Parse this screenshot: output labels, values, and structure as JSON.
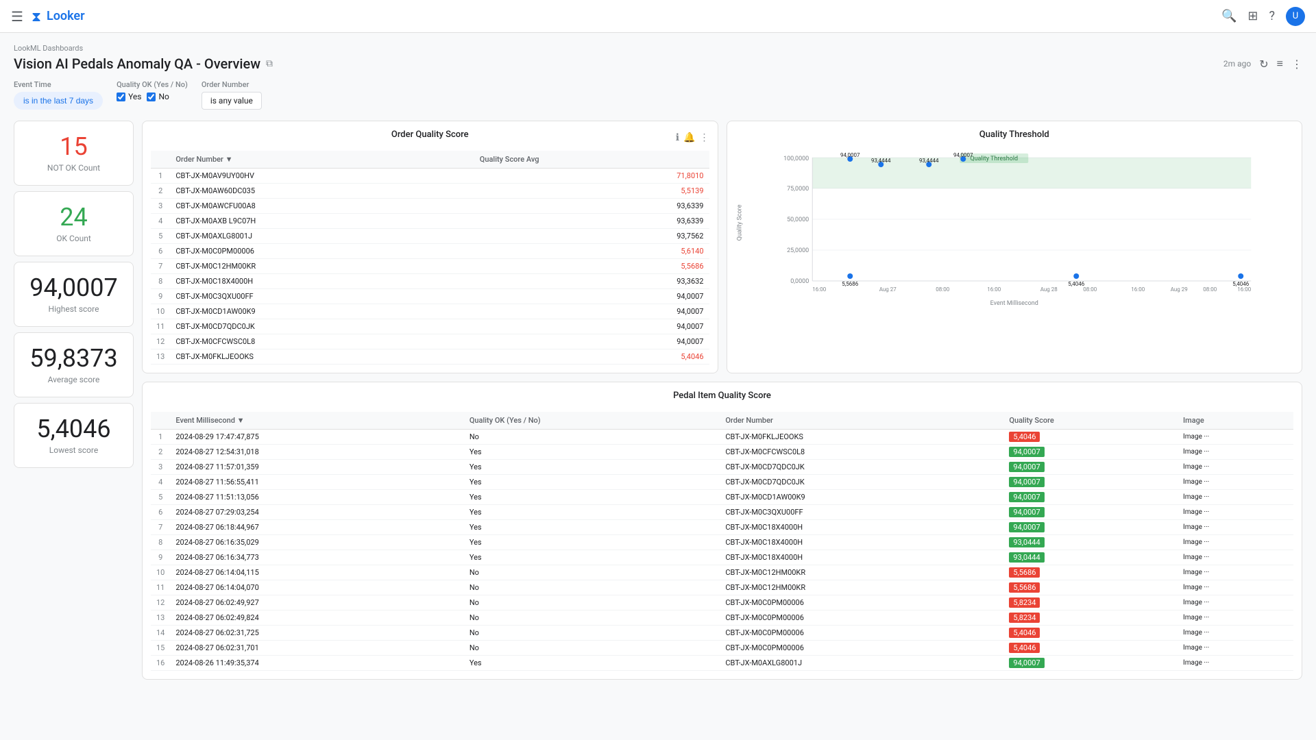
{
  "nav": {
    "logo": "Looker",
    "icons": [
      "☰",
      "⊞",
      "?",
      "👤"
    ]
  },
  "header": {
    "breadcrumb": "LookML Dashboards",
    "title": "Vision AI Pedals Anomaly QA - Overview",
    "last_updated": "2m ago"
  },
  "filters": {
    "event_time_label": "Event Time",
    "event_time_value": "is in the last 7 days",
    "quality_ok_label": "Quality OK (Yes / No)",
    "quality_ok_yes": "Yes",
    "quality_ok_no": "No",
    "order_number_label": "Order Number",
    "order_number_value": "is any value"
  },
  "kpis": {
    "not_ok_value": "15",
    "not_ok_label": "NOT OK Count",
    "ok_value": "24",
    "ok_label": "OK Count",
    "highest_value": "94,0007",
    "highest_label": "Highest score",
    "average_value": "59,8373",
    "average_label": "Average score",
    "lowest_value": "5,4046",
    "lowest_label": "Lowest score"
  },
  "order_quality_score": {
    "title": "Order Quality Score",
    "columns": [
      "",
      "Order Number",
      "Quality Score Avg"
    ],
    "rows": [
      {
        "num": 1,
        "order": "CBT-JX-M0AV9UY00HV",
        "score": "71,8010",
        "red": true
      },
      {
        "num": 2,
        "order": "CBT-JX-M0AW60DC035",
        "score": "5,5139",
        "red": true
      },
      {
        "num": 3,
        "order": "CBT-JX-M0AWCFU00A8",
        "score": "93,6339",
        "red": false
      },
      {
        "num": 4,
        "order": "CBT-JX-M0AXB L9C07H",
        "score": "93,6339",
        "red": false
      },
      {
        "num": 5,
        "order": "CBT-JX-M0AXLG8001J",
        "score": "93,7562",
        "red": false
      },
      {
        "num": 6,
        "order": "CBT-JX-M0C0PM00006",
        "score": "5,6140",
        "red": true
      },
      {
        "num": 7,
        "order": "CBT-JX-M0C12HM00KR",
        "score": "5,5686",
        "red": true
      },
      {
        "num": 8,
        "order": "CBT-JX-M0C18X4000H",
        "score": "93,3632",
        "red": false
      },
      {
        "num": 9,
        "order": "CBT-JX-M0C3QXU00FF",
        "score": "94,0007",
        "red": false
      },
      {
        "num": 10,
        "order": "CBT-JX-M0CD1AW00K9",
        "score": "94,0007",
        "red": false
      },
      {
        "num": 11,
        "order": "CBT-JX-M0CD7QDC0JK",
        "score": "94,0007",
        "red": false
      },
      {
        "num": 12,
        "order": "CBT-JX-M0CFCWSC0L8",
        "score": "94,0007",
        "red": false
      },
      {
        "num": 13,
        "order": "CBT-JX-M0FKLJEOOKS",
        "score": "5,4046",
        "red": true
      }
    ]
  },
  "quality_threshold": {
    "title": "Quality Threshold",
    "legend": "Quality Threshold",
    "y_axis_label": "Quality Score",
    "x_axis_label": "Event Millisecond",
    "y_ticks": [
      "100,0000",
      "75,0000",
      "50,0000",
      "25,0000",
      "0,0000"
    ],
    "x_ticks": [
      "16:00",
      "Aug 27",
      "08:00",
      "16:00",
      "Aug 28",
      "08:00",
      "16:00",
      "Aug 29",
      "08:00",
      "16:00"
    ],
    "points": [
      {
        "x": 70,
        "y": 15,
        "label": "94,0007",
        "color": "#1a73e8"
      },
      {
        "x": 100,
        "y": 12,
        "label": "93,4444",
        "color": "#1a73e8"
      },
      {
        "x": 160,
        "y": 12,
        "label": "93,4444",
        "color": "#1a73e8"
      },
      {
        "x": 210,
        "y": 12,
        "label": "94,0007",
        "color": "#1a73e8"
      },
      {
        "x": 330,
        "y": 82,
        "label": "5,5686",
        "color": "#1a73e8"
      },
      {
        "x": 440,
        "y": 82,
        "label": "5,4046",
        "color": "#1a73e8"
      },
      {
        "x": 800,
        "y": 82,
        "label": "5,4046",
        "color": "#1a73e8"
      }
    ]
  },
  "pedal_item_quality_score": {
    "title": "Pedal Item Quality Score",
    "columns": [
      "",
      "Event Millisecond",
      "Quality OK (Yes / No)",
      "Order Number",
      "Quality Score",
      "Image"
    ],
    "rows": [
      {
        "num": 1,
        "time": "2024-08-29 17:47:47,875",
        "ok": "No",
        "order": "CBT-JX-M0FKLJEOOKS",
        "score": "5,4046",
        "green": false
      },
      {
        "num": 2,
        "time": "2024-08-27 12:54:31,018",
        "ok": "Yes",
        "order": "CBT-JX-M0CFCWSC0L8",
        "score": "94,0007",
        "green": true
      },
      {
        "num": 3,
        "time": "2024-08-27 11:57:01,359",
        "ok": "Yes",
        "order": "CBT-JX-M0CD7QDC0JK",
        "score": "94,0007",
        "green": true
      },
      {
        "num": 4,
        "time": "2024-08-27 11:56:55,411",
        "ok": "Yes",
        "order": "CBT-JX-M0CD7QDC0JK",
        "score": "94,0007",
        "green": true
      },
      {
        "num": 5,
        "time": "2024-08-27 11:51:13,056",
        "ok": "Yes",
        "order": "CBT-JX-M0CD1AW00K9",
        "score": "94,0007",
        "green": true
      },
      {
        "num": 6,
        "time": "2024-08-27 07:29:03,254",
        "ok": "Yes",
        "order": "CBT-JX-M0C3QXU00FF",
        "score": "94,0007",
        "green": true
      },
      {
        "num": 7,
        "time": "2024-08-27 06:18:44,967",
        "ok": "Yes",
        "order": "CBT-JX-M0C18X4000H",
        "score": "94,0007",
        "green": true
      },
      {
        "num": 8,
        "time": "2024-08-27 06:16:35,029",
        "ok": "Yes",
        "order": "CBT-JX-M0C18X4000H",
        "score": "93,0444",
        "green": true
      },
      {
        "num": 9,
        "time": "2024-08-27 06:16:34,773",
        "ok": "Yes",
        "order": "CBT-JX-M0C18X4000H",
        "score": "93,0444",
        "green": true
      },
      {
        "num": 10,
        "time": "2024-08-27 06:14:04,115",
        "ok": "No",
        "order": "CBT-JX-M0C12HM00KR",
        "score": "5,5686",
        "green": false
      },
      {
        "num": 11,
        "time": "2024-08-27 06:14:04,070",
        "ok": "No",
        "order": "CBT-JX-M0C12HM00KR",
        "score": "5,5686",
        "green": false
      },
      {
        "num": 12,
        "time": "2024-08-27 06:02:49,927",
        "ok": "No",
        "order": "CBT-JX-M0C0PM00006",
        "score": "5,8234",
        "green": false
      },
      {
        "num": 13,
        "time": "2024-08-27 06:02:49,824",
        "ok": "No",
        "order": "CBT-JX-M0C0PM00006",
        "score": "5,8234",
        "green": false
      },
      {
        "num": 14,
        "time": "2024-08-27 06:02:31,725",
        "ok": "No",
        "order": "CBT-JX-M0C0PM00006",
        "score": "5,4046",
        "green": false
      },
      {
        "num": 15,
        "time": "2024-08-27 06:02:31,701",
        "ok": "No",
        "order": "CBT-JX-M0C0PM00006",
        "score": "5,4046",
        "green": false
      },
      {
        "num": 16,
        "time": "2024-08-26 11:49:35,374",
        "ok": "Yes",
        "order": "CBT-JX-M0AXLG8001J",
        "score": "94,0007",
        "green": true
      }
    ]
  }
}
